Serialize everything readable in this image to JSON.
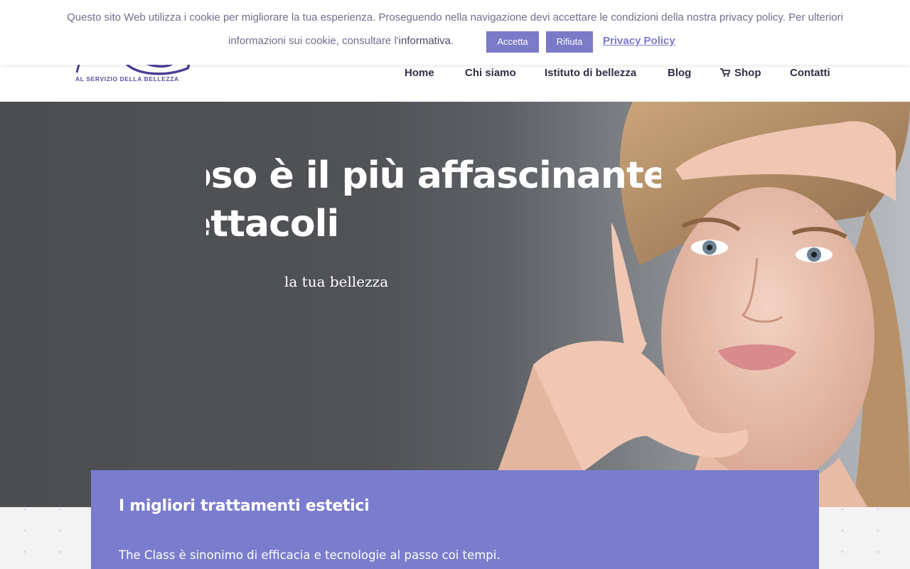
{
  "cookie_banner": {
    "text_line1": "Questo sito Web utilizza i cookie per migliorare la tua esperienza. Proseguendo nella navigazione devi accettare le condizioni della nostra privacy policy. Per ulteriori",
    "text_line2": "informazioni sui cookie, consultare l'",
    "info_link": "informativa",
    "period": ".",
    "accept_label": "Accetta",
    "reject_label": "Rifiuta",
    "privacy_label": "Privacy Policy",
    "accent_color": "#7b7ac9"
  },
  "header": {
    "logo_tagline": "AL SERVIZIO DELLA BELLEZZA",
    "nav": [
      {
        "label": "Home"
      },
      {
        "label": "Chi siamo"
      },
      {
        "label": "Istituto di bellezza"
      },
      {
        "label": "Blog"
      },
      {
        "label": "Shop",
        "icon": "cart-icon"
      },
      {
        "label": "Contatti"
      }
    ]
  },
  "hero": {
    "title_line1": "oso è il più affascinante",
    "title_line2": "ettacoli",
    "subtitle": "la tua bellezza"
  },
  "card": {
    "title": "I migliori trattamenti estetici",
    "text": "The Class è sinonimo di efficacia e tecnologie al passo coi tempi.",
    "color": "#7a7ccd"
  }
}
